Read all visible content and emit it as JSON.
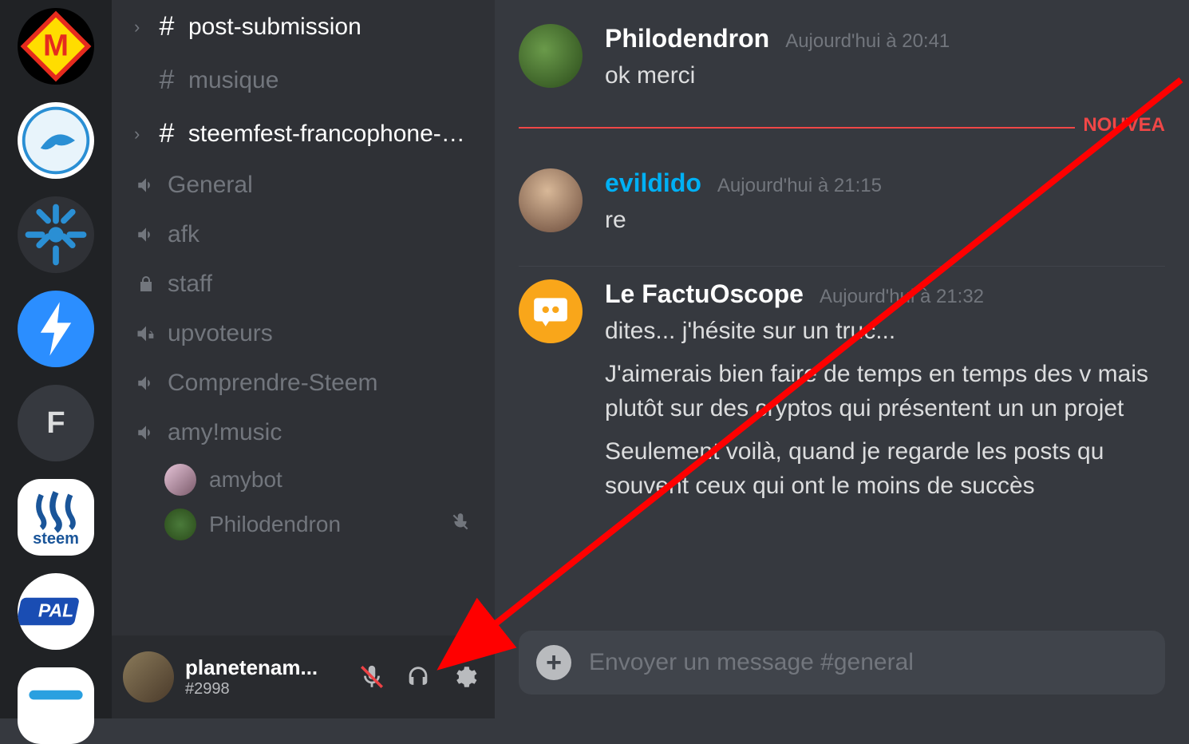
{
  "servers": [
    {
      "id": "m-server",
      "letter": "M"
    },
    {
      "id": "dolphin-server",
      "letter": ""
    },
    {
      "id": "bits-server",
      "letter": ""
    },
    {
      "id": "bolt-server",
      "letter": ""
    },
    {
      "id": "f-server",
      "letter": "F"
    },
    {
      "id": "steem-server",
      "letter": "steem"
    },
    {
      "id": "pal-server",
      "letter": "PAL"
    },
    {
      "id": "blank-server",
      "letter": ""
    }
  ],
  "channels": [
    {
      "type": "text",
      "label": "post-submission",
      "state": "active"
    },
    {
      "type": "text",
      "label": "musique",
      "state": "muted"
    },
    {
      "type": "text",
      "label": "steemfest-francophone-2...",
      "state": "active"
    },
    {
      "type": "voice",
      "label": "General",
      "state": "muted"
    },
    {
      "type": "voice",
      "label": "afk",
      "state": "muted"
    },
    {
      "type": "locked",
      "label": "staff",
      "state": "muted"
    },
    {
      "type": "voice-locked",
      "label": "upvoteurs",
      "state": "muted"
    },
    {
      "type": "voice",
      "label": "Comprendre-Steem",
      "state": "muted"
    },
    {
      "type": "voice",
      "label": "amy!music",
      "state": "muted"
    }
  ],
  "voice_members": [
    {
      "name": "amybot",
      "muted": false
    },
    {
      "name": "Philodendron",
      "muted": true
    }
  ],
  "user": {
    "name": "planetenam...",
    "tag": "#2998"
  },
  "divider": {
    "label": "NOUVEA"
  },
  "messages": [
    {
      "author": "Philodendron",
      "author_color": "white",
      "time": "Aujourd'hui à 20:41",
      "lines": [
        "ok merci"
      ],
      "avatar": "green"
    },
    {
      "author": "evildido",
      "author_color": "blue",
      "time": "Aujourd'hui à 21:15",
      "lines": [
        "re"
      ],
      "avatar": "photo"
    },
    {
      "author": "Le FactuOscope",
      "author_color": "white",
      "time": "Aujourd'hui à 21:32",
      "lines": [
        "dites... j'hésite sur un truc...",
        "J'aimerais bien faire de temps en temps des v mais plutôt sur des cryptos qui présentent un un projet",
        "Seulement voilà, quand je regarde les posts qu souvent ceux qui ont le moins de succès"
      ],
      "avatar": "discord"
    }
  ],
  "input": {
    "placeholder": "Envoyer un message #general"
  }
}
